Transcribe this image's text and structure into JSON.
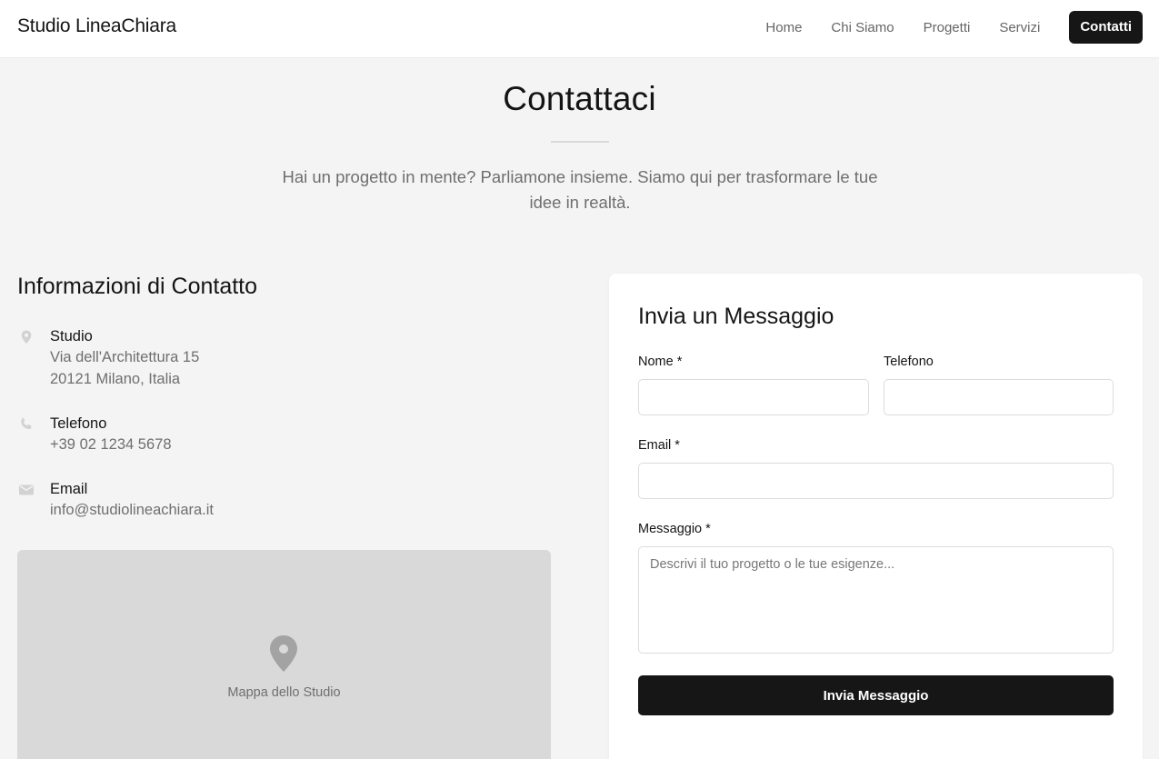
{
  "nav": {
    "brand": "Studio LineaChiara",
    "links": [
      {
        "label": "Home"
      },
      {
        "label": "Chi Siamo"
      },
      {
        "label": "Progetti"
      },
      {
        "label": "Servizi"
      },
      {
        "label": "Contatti"
      }
    ]
  },
  "hero": {
    "title": "Contattaci",
    "subtitle": "Hai un progetto in mente? Parliamone insieme. Siamo qui per trasformare le tue idee in realtà."
  },
  "contact_info": {
    "title": "Informazioni di Contatto",
    "studio": {
      "label": "Studio",
      "line1": "Via dell'Architettura 15",
      "line2": "20121 Milano, Italia",
      "icon": "location-pin-icon"
    },
    "phone": {
      "label": "Telefono",
      "value": "+39 02 1234 5678",
      "icon": "phone-icon"
    },
    "email": {
      "label": "Email",
      "value": "info@studiolineachiara.it",
      "icon": "mail-icon"
    },
    "map": {
      "caption": "Mappa dello Studio",
      "icon": "map-pin-icon"
    }
  },
  "form": {
    "title": "Invia un Messaggio",
    "nome_label": "Nome *",
    "nome_value": "",
    "telefono_label": "Telefono",
    "telefono_value": "",
    "email_label": "Email *",
    "email_value": "",
    "messaggio_label": "Messaggio *",
    "messaggio_placeholder": "Descrivi il tuo progetto o le tue esigenze...",
    "submit_label": "Invia Messaggio"
  },
  "colors": {
    "accent_dark": "#161616",
    "page_background": "#f4f4f4",
    "muted_text": "#6f6f6f",
    "map_fill": "#d9d9d9"
  }
}
